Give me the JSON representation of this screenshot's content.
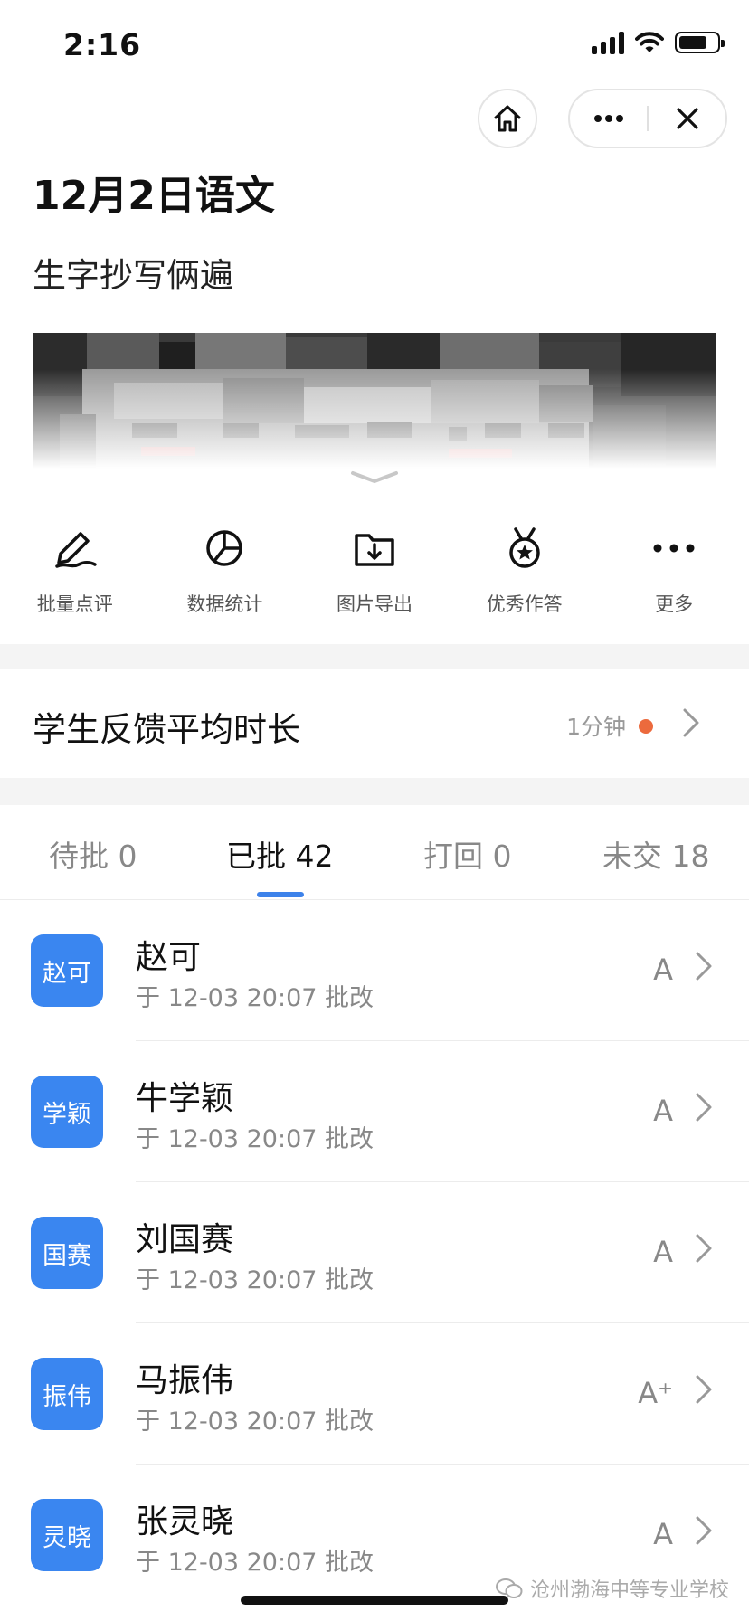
{
  "status_bar": {
    "time": "2:16"
  },
  "header": {
    "title": "12月2日语文",
    "subtitle": "生字抄写俩遍"
  },
  "actions": [
    {
      "label": "批量点评",
      "icon": "pen-signature-icon"
    },
    {
      "label": "数据统计",
      "icon": "pie-chart-icon"
    },
    {
      "label": "图片导出",
      "icon": "folder-download-icon"
    },
    {
      "label": "优秀作答",
      "icon": "medal-star-icon"
    },
    {
      "label": "更多",
      "icon": "more-dots-icon"
    }
  ],
  "feedback": {
    "label": "学生反馈平均时长",
    "value": "1分钟",
    "dot_color": "#ec6a3d"
  },
  "tabs": [
    {
      "label": "待批 0",
      "active": false
    },
    {
      "label": "已批 42",
      "active": true
    },
    {
      "label": "打回 0",
      "active": false
    },
    {
      "label": "未交 18",
      "active": false
    }
  ],
  "students": [
    {
      "avatar": "赵可",
      "name": "赵可",
      "meta": "于 12-03 20:07 批改",
      "grade": "A"
    },
    {
      "avatar": "学颖",
      "name": "牛学颖",
      "meta": "于 12-03 20:07 批改",
      "grade": "A"
    },
    {
      "avatar": "国赛",
      "name": "刘国赛",
      "meta": "于 12-03 20:07 批改",
      "grade": "A"
    },
    {
      "avatar": "振伟",
      "name": "马振伟",
      "meta": "于 12-03 20:07 批改",
      "grade": "A⁺"
    },
    {
      "avatar": "灵晓",
      "name": "张灵晓",
      "meta": "于 12-03 20:07 批改",
      "grade": "A"
    }
  ],
  "watermark": "沧州渤海中等专业学校",
  "colors": {
    "accent": "#3d82ea",
    "avatar_bg": "#3a86f0"
  }
}
